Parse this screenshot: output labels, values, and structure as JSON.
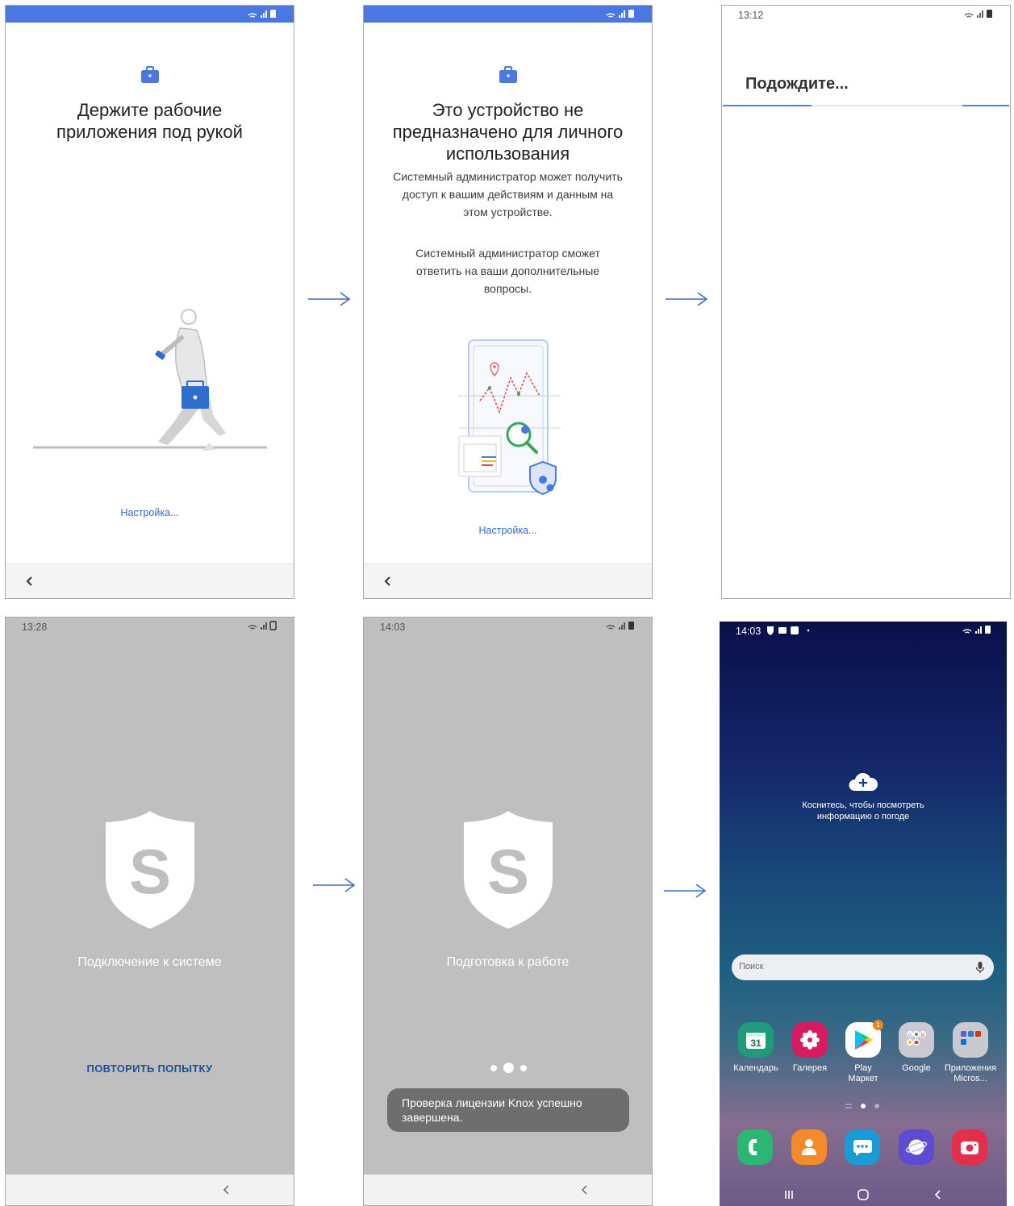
{
  "screen1": {
    "title": "Держите рабочие приложения под рукой",
    "setup_link": "Настройка..."
  },
  "screen2": {
    "title": "Это устройство не предназначено для личного использования",
    "body1": "Системный администратор может получить доступ к вашим действиям и данным на этом устройстве.",
    "body2": "Системный администратор сможет ответить на ваши дополнительные вопросы.",
    "setup_link": "Настройка..."
  },
  "screen3": {
    "time": "13:12",
    "title": "Подождите..."
  },
  "screen4": {
    "time": "13:28",
    "caption": "Подключение к системе",
    "retry_label": "ПОВТОРИТЬ ПОПЫТКУ"
  },
  "screen5": {
    "time": "14:03",
    "caption": "Подготовка к работе",
    "toast": "Проверка лицензии Knox успешно завершена."
  },
  "screen6": {
    "time": "14:03",
    "weather_text": "Коснитесь, чтобы посмотреть информацию о погоде",
    "search_placeholder": "Поиск",
    "apps": [
      {
        "label": "Календарь",
        "icon": "calendar-icon",
        "date": "31"
      },
      {
        "label": "Галерея",
        "icon": "gallery-icon"
      },
      {
        "label": "Play Маркет",
        "icon": "play-store-icon",
        "badge": "1"
      },
      {
        "label": "Google",
        "icon": "google-folder-icon"
      },
      {
        "label": "Приложения Micros...",
        "icon": "microsoft-folder-icon"
      }
    ],
    "dock": [
      {
        "icon": "phone-icon"
      },
      {
        "icon": "contacts-icon"
      },
      {
        "icon": "messages-icon"
      },
      {
        "icon": "internet-icon"
      },
      {
        "icon": "camera-icon"
      }
    ]
  },
  "colors": {
    "accent_blue": "#4a78e0",
    "link_blue": "#2f6ccc",
    "gray_screen": "#bfbfbf",
    "arrow_blue": "#3f6fc1"
  }
}
